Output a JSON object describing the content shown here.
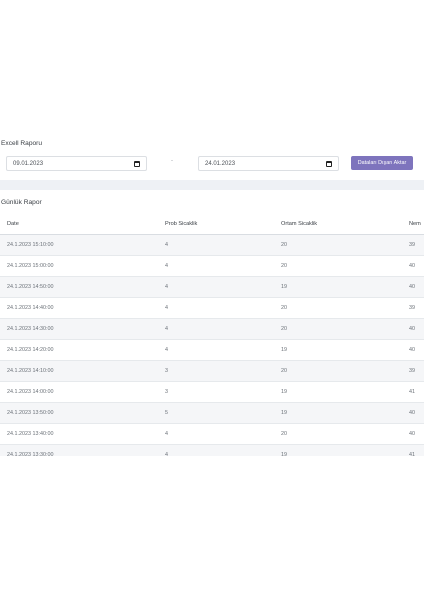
{
  "excel": {
    "title": "Excell Raporu",
    "start_date": "09.01.2023",
    "separator": "-",
    "end_date": "24.01.2023",
    "export_label": "Dataları Dışarı Aktar"
  },
  "report": {
    "title": "Günlük Rapor",
    "columns": [
      "Date",
      "Prob Sicaklik",
      "Ortam Sicaklik",
      "Nem"
    ],
    "rows": [
      [
        "24.1.2023 15:10:00",
        "4",
        "20",
        "39"
      ],
      [
        "24.1.2023 15:00:00",
        "4",
        "20",
        "40"
      ],
      [
        "24.1.2023 14:50:00",
        "4",
        "19",
        "40"
      ],
      [
        "24.1.2023 14:40:00",
        "4",
        "20",
        "39"
      ],
      [
        "24.1.2023 14:30:00",
        "4",
        "20",
        "40"
      ],
      [
        "24.1.2023 14:20:00",
        "4",
        "19",
        "40"
      ],
      [
        "24.1.2023 14:10:00",
        "3",
        "20",
        "39"
      ],
      [
        "24.1.2023 14:00:00",
        "3",
        "19",
        "41"
      ],
      [
        "24.1.2023 13:50:00",
        "5",
        "19",
        "40"
      ],
      [
        "24.1.2023 13:40:00",
        "4",
        "20",
        "40"
      ],
      [
        "24.1.2023 13:30:00",
        "4",
        "19",
        "41"
      ]
    ]
  },
  "colors": {
    "accent": "#7e74bd",
    "band": "#eef1f5",
    "stripe": "#f5f6f8"
  },
  "icons": {
    "date_picker": "calendar-icon"
  }
}
